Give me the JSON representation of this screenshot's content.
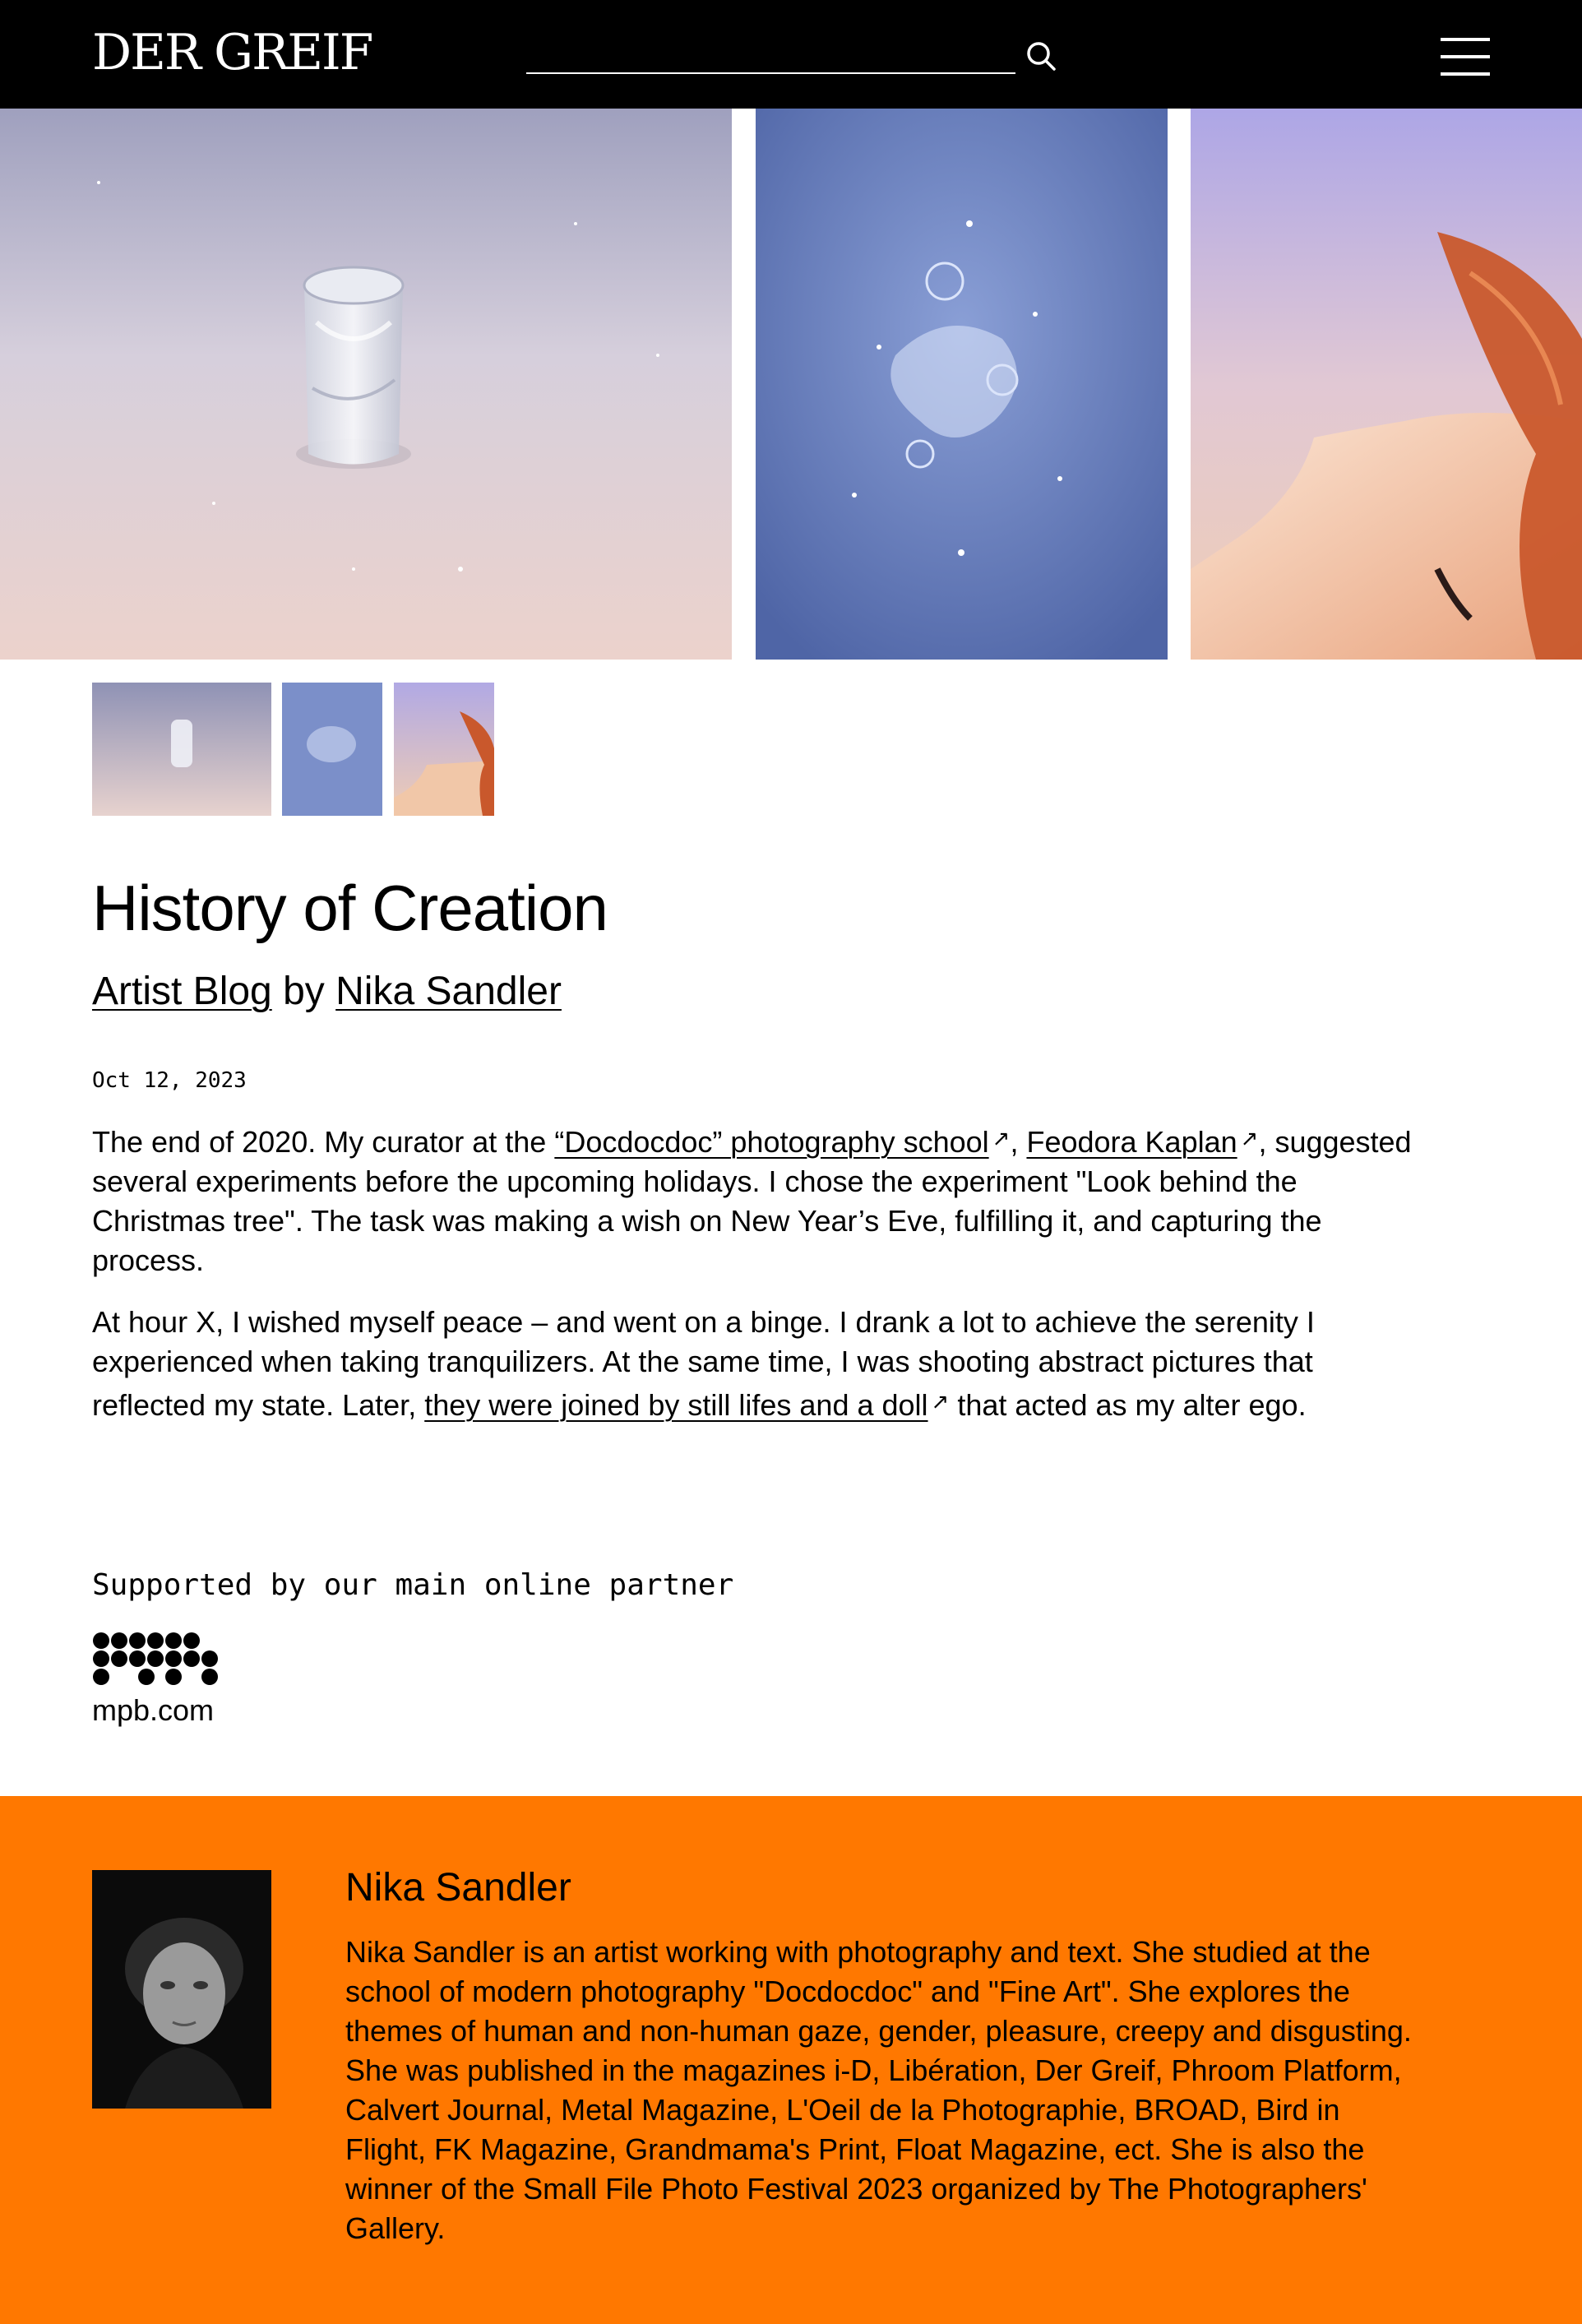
{
  "header": {
    "logo_text": "DER GREIF",
    "search_placeholder": ""
  },
  "article": {
    "title": "History of Creation",
    "category_link": "Artist Blog",
    "by_text": "by",
    "author_link": "Nika Sandler",
    "date": "Oct 12, 2023",
    "paragraph1": {
      "text_a": "The end of 2020. My curator at the ",
      "link_school": "“Docdocdoc” photography school",
      "text_comma": ", ",
      "link_curator": "Feodora Kaplan",
      "text_b": ", suggested several experiments before the upcoming holidays. I chose the experiment \"Look behind the Christmas tree\". The task was making a wish on New Year’s Eve, fulfilling it, and capturing the process."
    },
    "paragraph2": {
      "text_a": "At hour X, I wished myself peace – and went on a binge. I drank a lot to achieve the serenity I experienced when taking tranquilizers. At the same time, I was shooting abstract pictures that reflected my state. Later, ",
      "link_doll": "they were joined by still lifes and a doll",
      "text_b": " that acted as my alter ego."
    },
    "external_link_glyph": "↗"
  },
  "sponsor": {
    "label": "Supported by our main online partner",
    "name": "mpb.com"
  },
  "bio": {
    "name": "Nika Sandler",
    "text": "Nika Sandler is an artist working with photography and text. She studied at the school of modern photography \"Docdocdoc\" and \"Fine Art\". She explores the themes of human and non-human gaze, gender, pleasure, creepy and disgusting. She was published in the magazines i-D, Libération, Der Greif, Phroom Platform, Calvert Journal, Metal Magazine, L'Oeil de la Photographie, BROAD, Bird in Flight, FK Magazine, Grandmama's Print, Float Magazine, ect. She is also the winner of the Small File Photo Festival 2023 organized by The Photographers' Gallery."
  },
  "colors": {
    "header_bg": "#000000",
    "bio_bg": "#ff7800",
    "text": "#000000"
  },
  "icons": [
    "search-icon",
    "menu-icon",
    "external-link-icon"
  ]
}
